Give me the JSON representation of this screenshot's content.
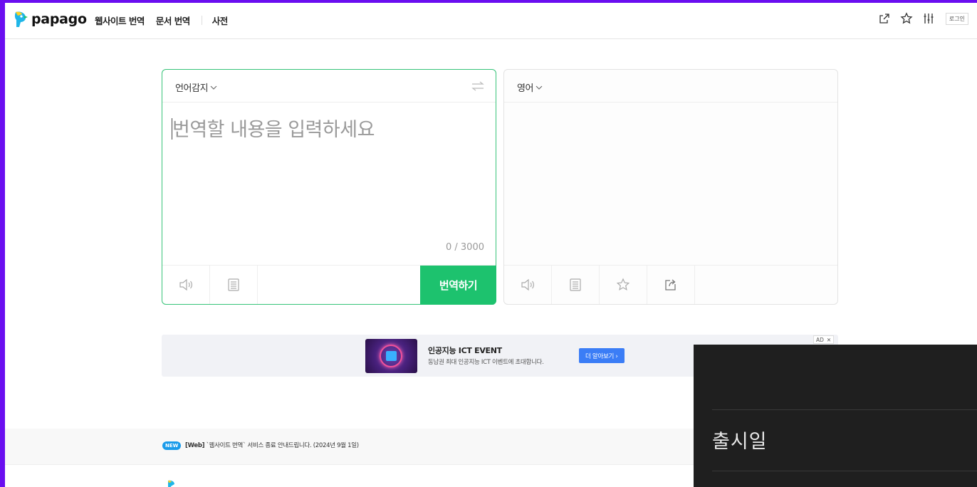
{
  "header": {
    "logo_text": "papago",
    "nav": [
      {
        "label": "웹사이트 번역"
      },
      {
        "label": "문서 번역"
      },
      {
        "label": "사전"
      }
    ],
    "login_label": "로그인",
    "tool_icons": [
      "share-icon",
      "star-icon",
      "settings-sliders-icon"
    ]
  },
  "source": {
    "language": "언어감지",
    "placeholder": "번역할 내용을 입력하세요",
    "counter": "0 / 3000",
    "translate_label": "번역하기"
  },
  "target": {
    "language": "영어"
  },
  "ad": {
    "title": "인공지능 ICT EVENT",
    "description": "동남권 최대 인공지능 ICT 이벤트에 초대합니다.",
    "cta": "더 알아보기 ›",
    "badge": "AD"
  },
  "notice": {
    "badge": "NEW",
    "tag": "[Web]",
    "text": "`웹사이트 번역` 서비스 종료 안내드립니다. (2024년 9월 1일)"
  },
  "overlay": {
    "title": "출시일"
  },
  "colors": {
    "brand_green": "#1dc26e",
    "border_green": "#36c378",
    "ad_button": "#3b7df6",
    "new_badge": "#1a9bea",
    "frame": "#6a0ef0"
  }
}
